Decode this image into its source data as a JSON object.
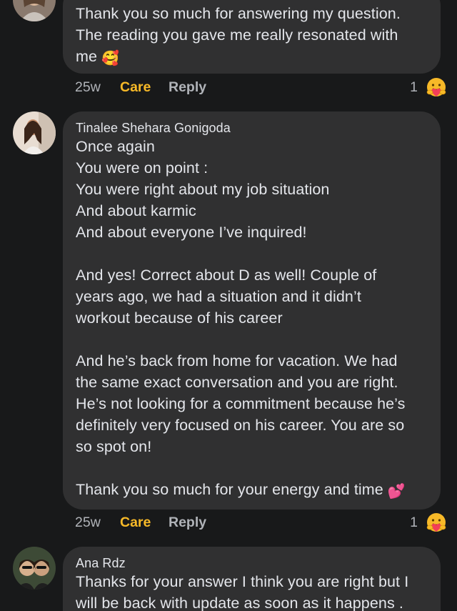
{
  "colors": {
    "background": "#18191a",
    "bubble": "#303031",
    "text": "#e4e6eb",
    "meta_text": "#b0b3b8",
    "care_accent": "#f7b928"
  },
  "comments": [
    {
      "author": "",
      "text": "Thank you so much for answering my question.\nThe reading you gave me really resonated with\nme",
      "emoji": "🥰",
      "time": "25w",
      "reaction_label": "Care",
      "reply_label": "Reply",
      "reaction_count": "1",
      "reaction_icon": "care-face-icon"
    },
    {
      "author": "Tinalee Shehara Gonigoda",
      "text": "Once again\nYou were on point :\nYou were right about my job situation\nAnd about karmic\nAnd about everyone I’ve inquired!\n\nAnd yes! Correct about D as well! Couple of\nyears ago, we had a situation and it didn’t\nworkout because of his career\n\nAnd he’s back from home for vacation. We had\nthe same exact conversation and you are right.\nHe’s not looking for a commitment because he’s\ndefinitely very focused on his career. You are so\nso spot on!\n\nThank you so much for your energy and time",
      "emoji": "💕",
      "time": "25w",
      "reaction_label": "Care",
      "reply_label": "Reply",
      "reaction_count": "1",
      "reaction_icon": "care-face-icon"
    },
    {
      "author": "Ana Rdz",
      "text": "Thanks for your answer I think you are right but I\nwill be back with update as soon as it happens ."
    }
  ]
}
